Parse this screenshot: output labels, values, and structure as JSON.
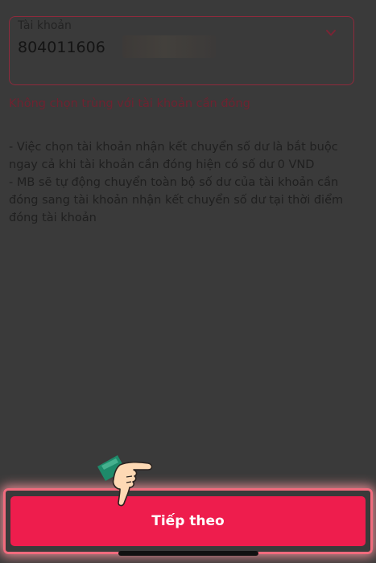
{
  "account": {
    "label": "Tài khoản",
    "number": "804011606"
  },
  "icons": {
    "dropdown": "chevron-down-icon",
    "pointer": "pointing-hand-icon"
  },
  "warning": "Không chọn trùng với tài khoản cần đóng",
  "notes": [
    "- Việc chọn tài khoản nhận kết chuyển số dư là bắt buộc ngay cả khi tài khoản cần đóng hiện có số dư 0 VND",
    "- MB sẽ tự động chuyển toàn bộ số dư của tài khoản cần đóng sang tài khoản nhận kết chuyển số dư tại thời điểm đóng tài khoản"
  ],
  "cta": {
    "label": "Tiếp theo"
  },
  "colors": {
    "overlay_background": "#3a3a3a",
    "accent": "#ee1d4d",
    "field_border": "#8e2a3c",
    "warning_text": "#6e2230"
  }
}
